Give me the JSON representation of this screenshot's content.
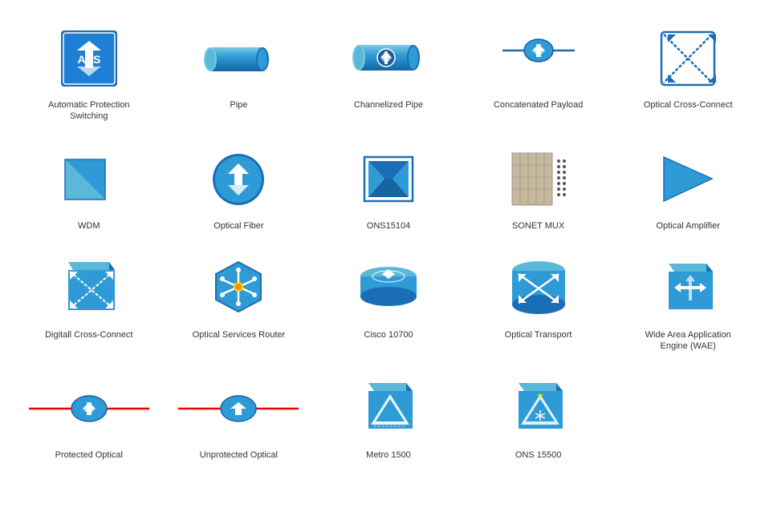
{
  "items": [
    {
      "id": "aps",
      "label": "Automatic Protection Switching",
      "type": "aps"
    },
    {
      "id": "pipe",
      "label": "Pipe",
      "type": "pipe"
    },
    {
      "id": "channelized-pipe",
      "label": "Channelized Pipe",
      "type": "channelized-pipe"
    },
    {
      "id": "concatenated-payload",
      "label": "Concatenated Payload",
      "type": "concatenated-payload"
    },
    {
      "id": "optical-cross-connect",
      "label": "Optical Cross-Connect",
      "type": "optical-cross-connect"
    },
    {
      "id": "wdm",
      "label": "WDM",
      "type": "wdm"
    },
    {
      "id": "optical-fiber",
      "label": "Optical Fiber",
      "type": "optical-fiber"
    },
    {
      "id": "ons15104",
      "label": "ONS15104",
      "type": "ons15104"
    },
    {
      "id": "sonet-mux",
      "label": "SONET MUX",
      "type": "sonet-mux"
    },
    {
      "id": "optical-amplifier",
      "label": "Optical Amplifier",
      "type": "optical-amplifier"
    },
    {
      "id": "digitall-cross-connect",
      "label": "Digitall Cross-Connect",
      "type": "digitall-cross-connect"
    },
    {
      "id": "optical-services-router",
      "label": "Optical Services Router",
      "type": "optical-services-router"
    },
    {
      "id": "cisco-10700",
      "label": "Cisco 10700",
      "type": "cisco-10700"
    },
    {
      "id": "optical-transport",
      "label": "Optical Transport",
      "type": "optical-transport"
    },
    {
      "id": "wae",
      "label": "Wide Area Application Engine (WAE)",
      "type": "wae"
    },
    {
      "id": "protected-optical",
      "label": "Protected Optical",
      "type": "protected-optical"
    },
    {
      "id": "unprotected-optical",
      "label": "Unprotected Optical",
      "type": "unprotected-optical"
    },
    {
      "id": "metro-1500",
      "label": "Metro 1500",
      "type": "metro-1500"
    },
    {
      "id": "ons-15500",
      "label": "ONS 15500",
      "type": "ons-15500"
    }
  ]
}
